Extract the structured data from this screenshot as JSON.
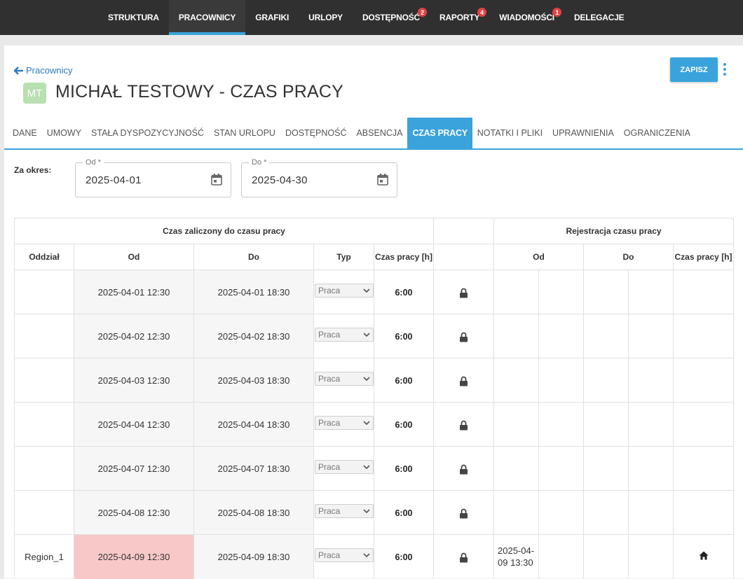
{
  "nav": [
    {
      "label": "STRUKTURA",
      "badge": ""
    },
    {
      "label": "PRACOWNICY",
      "badge": "",
      "active": true
    },
    {
      "label": "GRAFIKI",
      "badge": ""
    },
    {
      "label": "URLOPY",
      "badge": ""
    },
    {
      "label": "DOSTĘPNOŚĆ",
      "badge": "2"
    },
    {
      "label": "RAPORTY",
      "badge": "4"
    },
    {
      "label": "WIADOMOŚCI",
      "badge": "1"
    },
    {
      "label": "DELEGACJE",
      "badge": ""
    }
  ],
  "header": {
    "back_label": "Pracownicy",
    "avatar_initials": "MT",
    "title": "MICHAŁ TESTOWY - CZAS PRACY",
    "save_label": "ZAPISZ"
  },
  "tabs": [
    {
      "label": "DANE"
    },
    {
      "label": "UMOWY"
    },
    {
      "label": "STAŁA DYSPOZYCYJNOŚĆ"
    },
    {
      "label": "STAN URLOPU"
    },
    {
      "label": "DOSTĘPNOŚĆ"
    },
    {
      "label": "ABSENCJA"
    },
    {
      "label": "CZAS PRACY",
      "active": true
    },
    {
      "label": "NOTATKI I PLIKI"
    },
    {
      "label": "UPRAWNIENIA"
    },
    {
      "label": "OGRANICZENIA"
    }
  ],
  "period": {
    "label": "Za okres:",
    "from_label": "Od *",
    "from_value": "2025-04-01",
    "to_label": "Do *",
    "to_value": "2025-04-30"
  },
  "table": {
    "group_counted": "Czas zaliczony do czasu pracy",
    "group_registration": "Rejestracja czasu pracy",
    "columns": {
      "oddzial": "Oddział",
      "od": "Od",
      "do": "Do",
      "typ": "Typ",
      "czas": "Czas pracy [h]",
      "reg_od": "Od",
      "reg_do": "Do",
      "reg_czas": "Czas pracy [h]"
    },
    "rows": [
      {
        "oddzial": "",
        "od": "2025-04-01 12:30",
        "do": "2025-04-01 18:30",
        "typ": "Praca",
        "czas": "6:00",
        "reg_od": "",
        "highlight": false,
        "home": false
      },
      {
        "oddzial": "",
        "od": "2025-04-02 12:30",
        "do": "2025-04-02 18:30",
        "typ": "Praca",
        "czas": "6:00",
        "reg_od": "",
        "highlight": false,
        "home": false
      },
      {
        "oddzial": "",
        "od": "2025-04-03 12:30",
        "do": "2025-04-03 18:30",
        "typ": "Praca",
        "czas": "6:00",
        "reg_od": "",
        "highlight": false,
        "home": false
      },
      {
        "oddzial": "",
        "od": "2025-04-04 12:30",
        "do": "2025-04-04 18:30",
        "typ": "Praca",
        "czas": "6:00",
        "reg_od": "",
        "highlight": false,
        "home": false
      },
      {
        "oddzial": "",
        "od": "2025-04-07 12:30",
        "do": "2025-04-07 18:30",
        "typ": "Praca",
        "czas": "6:00",
        "reg_od": "",
        "highlight": false,
        "home": false
      },
      {
        "oddzial": "",
        "od": "2025-04-08 12:30",
        "do": "2025-04-08 18:30",
        "typ": "Praca",
        "czas": "6:00",
        "reg_od": "",
        "highlight": false,
        "home": false
      },
      {
        "oddzial": "Region_1",
        "od": "2025-04-09 12:30",
        "do": "2025-04-09 18:30",
        "typ": "Praca",
        "czas": "6:00",
        "reg_od": "2025-04-09 13:30",
        "highlight": true,
        "home": true
      }
    ]
  },
  "colors": {
    "accent": "#3aa3dc",
    "topbar": "#303030",
    "badge": "#e04343",
    "highlight_row": "#f8c8c8",
    "avatar": "#b8e0b0"
  },
  "icons": {
    "back": "arrow-left-icon",
    "calendar": "calendar-icon",
    "lock": "lock-icon",
    "home": "home-icon",
    "menu": "kebab-menu-icon",
    "dropdown": "chevron-down-icon"
  }
}
